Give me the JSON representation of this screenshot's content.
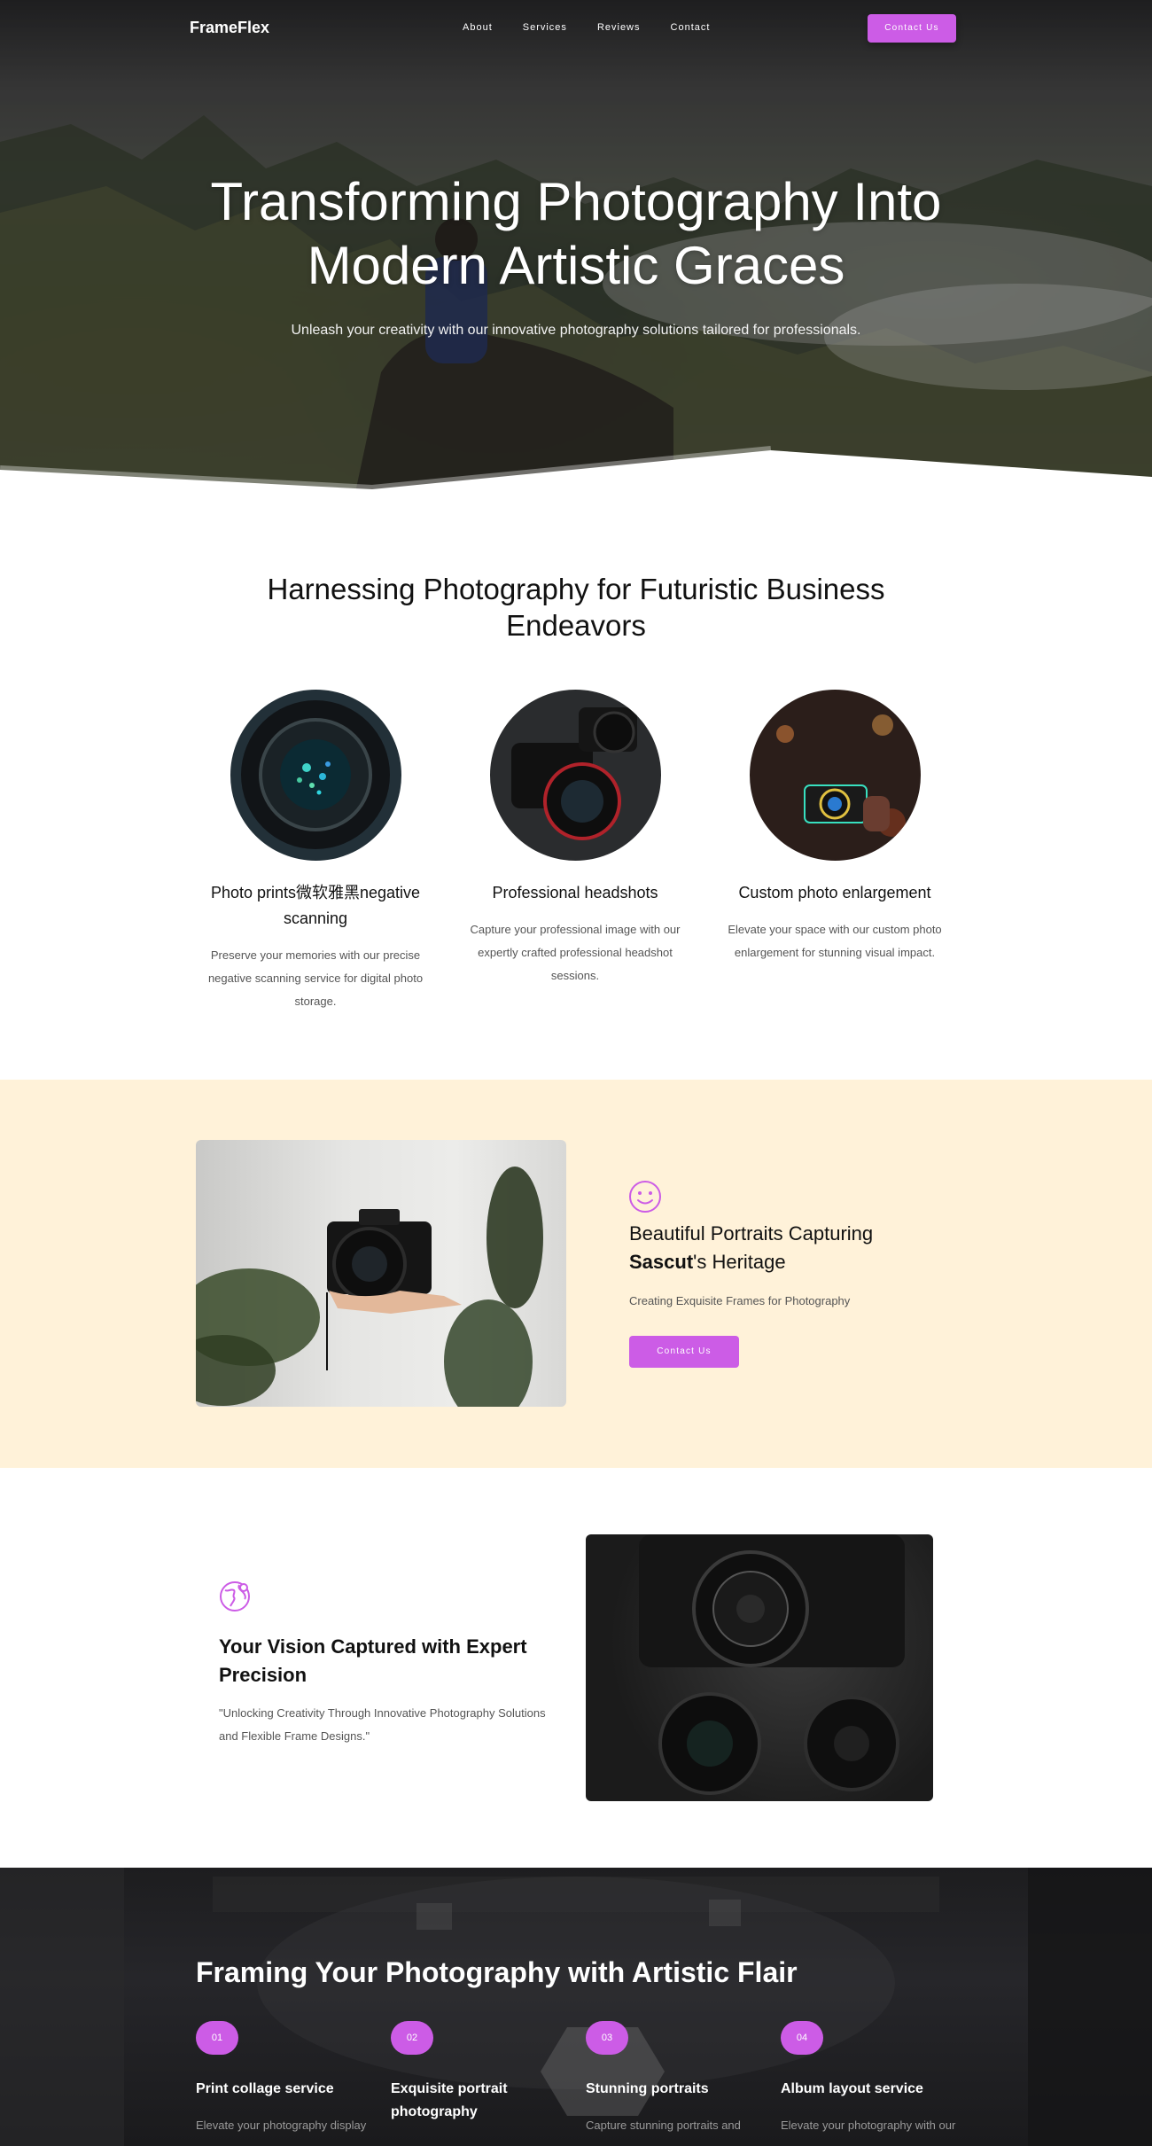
{
  "brand": {
    "name": "FrameFlex",
    "accent": "#cc5ce6"
  },
  "nav": {
    "links": [
      "About",
      "Services",
      "Reviews",
      "Contact"
    ],
    "cta": "Contact Us"
  },
  "hero": {
    "title": "Transforming Photography Into Modern Artistic Graces",
    "subtitle": "Unleash your creativity with our innovative photography solutions tailored for professionals."
  },
  "services": {
    "title": "Harnessing Photography for Futuristic Business Endeavors",
    "items": [
      {
        "name": "Photo prints微软雅黑negative scanning",
        "desc": "Preserve your memories with our precise negative scanning service for digital photo storage."
      },
      {
        "name": "Professional headshots",
        "desc": "Capture your professional image with our expertly crafted professional headshot sessions."
      },
      {
        "name": "Custom photo enlargement",
        "desc": "Elevate your space with our custom photo enlargement for stunning visual impact."
      }
    ]
  },
  "feature": {
    "icon": "smiley-icon",
    "title_prefix": "Beautiful Portraits Capturing",
    "title_bold": "Sascut",
    "title_suffix": "'s Heritage",
    "subtitle": "Creating Exquisite Frames for Photography",
    "cta": "Contact Us",
    "background": "#fff2d9"
  },
  "vision": {
    "icon": "globe-icon",
    "title": "Your Vision Captured with Expert Precision",
    "quote": "\"Unlocking Creativity Through Innovative Photography Solutions and Flexible Frame Designs.\""
  },
  "framing": {
    "title": "Framing Your Photography with Artistic Flair",
    "steps": [
      {
        "num": "01",
        "title": "Print collage service",
        "desc": "Elevate your photography display"
      },
      {
        "num": "02",
        "title": "Exquisite portrait photography",
        "desc": ""
      },
      {
        "num": "03",
        "title": "Stunning portraits",
        "desc": "Capture stunning portraits and"
      },
      {
        "num": "04",
        "title": "Album layout service",
        "desc": "Elevate your photography with our"
      }
    ]
  }
}
